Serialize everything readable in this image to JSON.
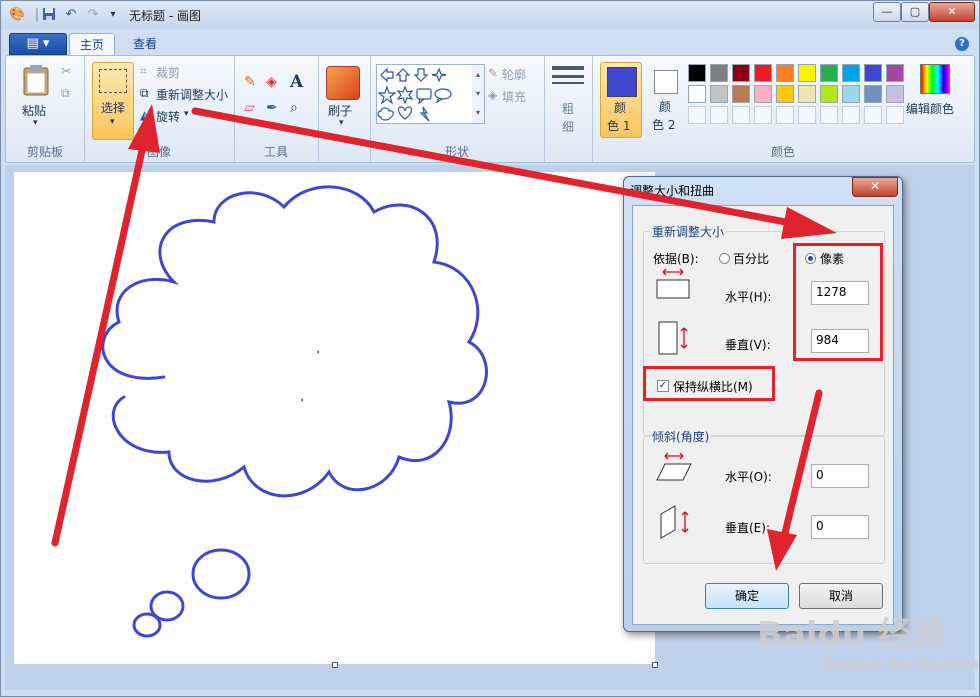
{
  "window": {
    "title": "无标题 - 画图",
    "minimize": "—",
    "maximize": "▢",
    "close": "✕"
  },
  "tabs": {
    "file": "▤ ▾",
    "home": "主页",
    "view": "查看"
  },
  "help": "?",
  "ribbon": {
    "clipboard": {
      "label": "剪贴板",
      "paste": "粘贴",
      "paste_arrow": "▾",
      "cut_icon": "scissors-icon",
      "copy_icon": "copy-icon"
    },
    "image": {
      "label": "图像",
      "select": "选择",
      "select_arrow": "▾",
      "crop": "裁剪",
      "resize": "重新调整大小",
      "rotate": "旋转",
      "rotate_arrow": "▾"
    },
    "tools": {
      "label": "工具"
    },
    "brushes": {
      "label": "刷子",
      "arrow": "▾"
    },
    "shapes": {
      "label": "形状",
      "outline": "轮廓",
      "fill": "填充"
    },
    "size": {
      "label1": "粗",
      "label2": "细"
    },
    "color1": {
      "label1": "颜",
      "label2": "色 1",
      "value": "#3f48cc"
    },
    "color2": {
      "label1": "颜",
      "label2": "色 2",
      "value": "#ffffff"
    },
    "colors": {
      "label": "颜色",
      "edit": "编辑颜色",
      "row1": [
        "#000000",
        "#7f7f7f",
        "#880015",
        "#ed1c24",
        "#ff7f27",
        "#fff200",
        "#22b14c",
        "#00a2e8",
        "#3f48cc",
        "#a349a4"
      ],
      "row2": [
        "#ffffff",
        "#c3c3c3",
        "#b97a57",
        "#ffaec9",
        "#ffc90e",
        "#efe4b0",
        "#b5e61d",
        "#99d9ea",
        "#7092be",
        "#c8bfe7"
      ]
    }
  },
  "dialog": {
    "title": "调整大小和扭曲",
    "close": "✕",
    "resize": {
      "legend": "重新调整大小",
      "by": "依据(B):",
      "percent": "百分比",
      "pixels": "像素",
      "horizontal_label": "水平(H):",
      "horizontal_value": "1278",
      "vertical_label": "垂直(V):",
      "vertical_value": "984",
      "keep_ratio": "保持纵横比(M)",
      "keep_ratio_checked": "✓"
    },
    "skew": {
      "legend": "倾斜(角度)",
      "horizontal_label": "水平(O):",
      "horizontal_value": "0",
      "vertical_label": "垂直(E):",
      "vertical_value": "0"
    },
    "ok": "确定",
    "cancel": "取消"
  },
  "watermark": {
    "brand": "Baidu 经验",
    "url": "jingyan.baidu.com"
  }
}
